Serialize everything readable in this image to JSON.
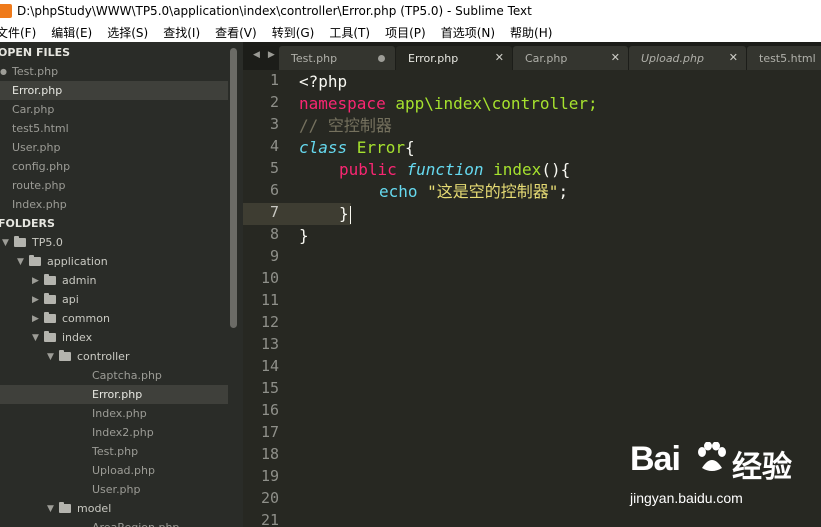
{
  "window": {
    "title": "D:\\phpStudy\\WWW\\TP5.0\\application\\index\\controller\\Error.php (TP5.0) - Sublime Text"
  },
  "menu": [
    "文件(F)",
    "编辑(E)",
    "选择(S)",
    "查找(I)",
    "查看(V)",
    "转到(G)",
    "工具(T)",
    "项目(P)",
    "首选项(N)",
    "帮助(H)"
  ],
  "sidebar": {
    "open_files_header": "OPEN FILES",
    "open_files": [
      "Test.php",
      "Error.php",
      "Car.php",
      "test5.html",
      "User.php",
      "config.php",
      "route.php",
      "Index.php"
    ],
    "folders_header": "FOLDERS",
    "root": "TP5.0",
    "application": "application",
    "subfolders": [
      "admin",
      "api",
      "common",
      "index"
    ],
    "controller": "controller",
    "controller_files": [
      "Captcha.php",
      "Error.php",
      "Index.php",
      "Index2.php",
      "Test.php",
      "Upload.php",
      "User.php"
    ],
    "model": "model",
    "model_files": [
      "AreaRegion.php"
    ]
  },
  "tabs": [
    {
      "label": "Test.php",
      "state": "modified"
    },
    {
      "label": "Error.php",
      "state": "active"
    },
    {
      "label": "Car.php",
      "state": "normal"
    },
    {
      "label": "Upload.php",
      "state": "preview"
    },
    {
      "label": "test5.html",
      "state": "normal"
    }
  ],
  "editor": {
    "line_numbers": [
      "1",
      "2",
      "3",
      "4",
      "5",
      "6",
      "7",
      "8",
      "9",
      "10",
      "11",
      "12",
      "13",
      "14",
      "15",
      "16",
      "17",
      "18",
      "19",
      "20",
      "21"
    ],
    "active_line": 7,
    "code": {
      "l1": "<?php",
      "l2_kw": "namespace",
      "l2_ns": " app\\index\\controller;",
      "l3": "// 空控制器",
      "l4_kw": "class",
      "l4_name": " Error",
      "l4_end": "{",
      "l5_kw": "public",
      "l5_fn_kw": "function",
      "l5_name": "index",
      "l5_end": "(){",
      "l6_echo": "echo",
      "l6_str": "\"这是空的控制器\"",
      "l6_end": ";",
      "l7": "}",
      "l8": "}"
    }
  },
  "watermark": {
    "logo": "Bai",
    "logo2": "经验",
    "url": "jingyan.baidu.com"
  },
  "colors": {
    "background": "#272822",
    "keyword": "#f92672",
    "function": "#a6e22e",
    "string": "#e6db74",
    "comment": "#75715e"
  }
}
